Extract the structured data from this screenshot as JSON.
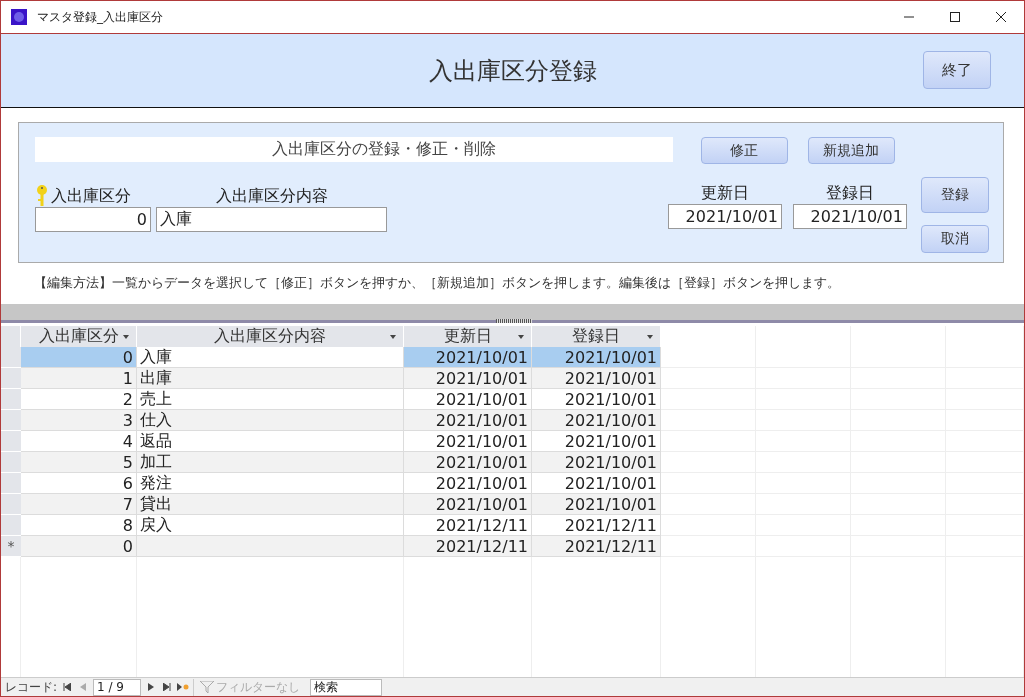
{
  "window": {
    "title": "マスタ登録_入出庫区分"
  },
  "header": {
    "title": "入出庫区分登録",
    "exit_button": "終了"
  },
  "form": {
    "section_title": "入出庫区分の登録・修正・削除",
    "top_buttons": [
      "修正",
      "新規追加"
    ],
    "fields": [
      {
        "label": "入出庫区分",
        "value": "0",
        "key": true
      },
      {
        "label": "入出庫区分内容",
        "value": "入庫",
        "key": false
      }
    ],
    "dates": [
      {
        "label": "更新日",
        "value": "2021/10/01"
      },
      {
        "label": "登録日",
        "value": "2021/10/01"
      }
    ],
    "side_buttons": [
      "登録",
      "取消"
    ]
  },
  "instructions": "【編集方法】一覧からデータを選択して［修正］ボタンを押すか、［新規追加］ボタンを押します。編集後は［登録］ボタンを押します。",
  "datasheet": {
    "columns": [
      "入出庫区分",
      "入出庫区分内容",
      "更新日",
      "登録日"
    ],
    "rows": [
      {
        "kind": "record",
        "selected": true,
        "cells": [
          "0",
          "入庫",
          "2021/10/01",
          "2021/10/01"
        ]
      },
      {
        "kind": "record",
        "selected": false,
        "cells": [
          "1",
          "出庫",
          "2021/10/01",
          "2021/10/01"
        ]
      },
      {
        "kind": "record",
        "selected": false,
        "cells": [
          "2",
          "売上",
          "2021/10/01",
          "2021/10/01"
        ]
      },
      {
        "kind": "record",
        "selected": false,
        "cells": [
          "3",
          "仕入",
          "2021/10/01",
          "2021/10/01"
        ]
      },
      {
        "kind": "record",
        "selected": false,
        "cells": [
          "4",
          "返品",
          "2021/10/01",
          "2021/10/01"
        ]
      },
      {
        "kind": "record",
        "selected": false,
        "cells": [
          "5",
          "加工",
          "2021/10/01",
          "2021/10/01"
        ]
      },
      {
        "kind": "record",
        "selected": false,
        "cells": [
          "6",
          "発注",
          "2021/10/01",
          "2021/10/01"
        ]
      },
      {
        "kind": "record",
        "selected": false,
        "cells": [
          "7",
          "貸出",
          "2021/10/01",
          "2021/10/01"
        ]
      },
      {
        "kind": "record",
        "selected": false,
        "cells": [
          "8",
          "戻入",
          "2021/12/11",
          "2021/12/11"
        ]
      },
      {
        "kind": "new",
        "selected": false,
        "marker": "*",
        "cells": [
          "0",
          "",
          "2021/12/11",
          "2021/12/11"
        ]
      }
    ]
  },
  "navigation": {
    "label": "レコード:",
    "position": "1 / 9",
    "filter": "フィルターなし",
    "search_placeholder": "検索"
  }
}
